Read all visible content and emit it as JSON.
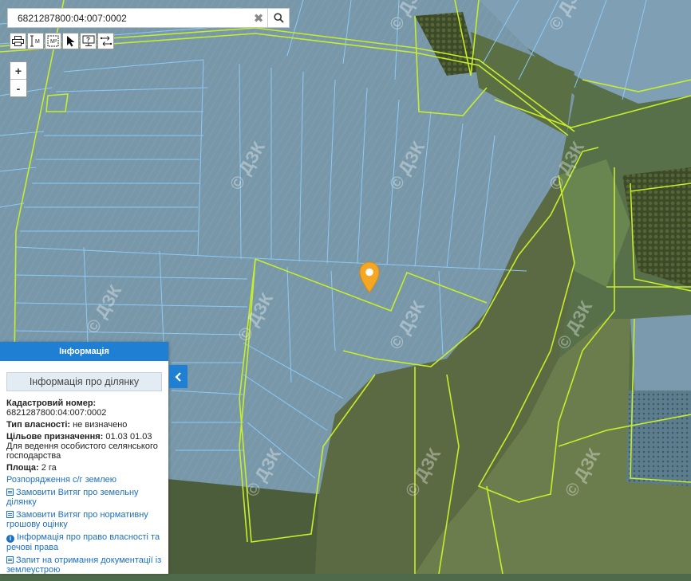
{
  "search": {
    "value": "6821287800:04:007:0002",
    "clear_icon": "close-icon",
    "search_icon": "search-icon"
  },
  "toolbar": [
    "print-icon",
    "measure-length-icon",
    "measure-area-icon",
    "pointer-icon",
    "identify-icon",
    "layers-icon"
  ],
  "zoom": {
    "in_label": "+",
    "out_label": "-"
  },
  "watermark": "© ДЗК",
  "panel": {
    "header": "Інформація",
    "subtitle": "Інформація про ділянку",
    "cadastral_label": "Кадастровий номер:",
    "cadastral_value": "6821287800:04:007:0002",
    "ownership_label": "Тип власності:",
    "ownership_value": "не визначено",
    "purpose_label": "Цільове призначення:",
    "purpose_value": "01.03 01.03 Для ведення особистого селянського господарства",
    "area_label": "Площа:",
    "area_value": "2 га",
    "disposal_link": "Розпорядження с/г землею",
    "links": [
      "Замовити Витяг про земельну ділянку",
      "Замовити Витяг про нормативну грошову оцінку",
      "Інформація про право власності та речові права",
      "Запит на отримання документації із землеустрою"
    ]
  },
  "colors": {
    "accent": "#1e7fd3",
    "pin": "#f5a623",
    "parcel_line": "#8fd0ff",
    "boundary_line": "#c6ee2a"
  }
}
